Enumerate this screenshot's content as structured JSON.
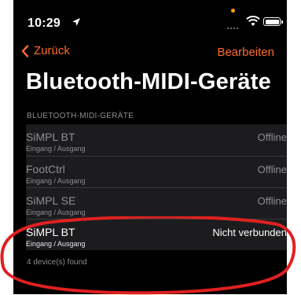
{
  "status_bar": {
    "time": "10:29"
  },
  "nav": {
    "back_label": "Zurück",
    "edit_label": "Bearbeiten"
  },
  "page": {
    "title": "Bluetooth-MIDI-Geräte",
    "section_header": "BLUETOOTH-MIDI-GERÄTE",
    "footer": "4 device(s) found"
  },
  "devices": [
    {
      "name": "SiMPL BT",
      "direction": "Eingang / Ausgang",
      "status": "Offline"
    },
    {
      "name": "FootCtrl",
      "direction": "Eingang / Ausgang",
      "status": "Offline"
    },
    {
      "name": "SiMPL SE",
      "direction": "Eingang / Ausgang",
      "status": "Offline"
    },
    {
      "name": "SiMPL BT",
      "direction": "Eingang / Ausgang",
      "status": "Nicht verbunden"
    }
  ],
  "colors": {
    "accent": "#ff6b2c",
    "annotation": "#e02020",
    "background": "#000000",
    "cell": "#1c1c1e"
  }
}
